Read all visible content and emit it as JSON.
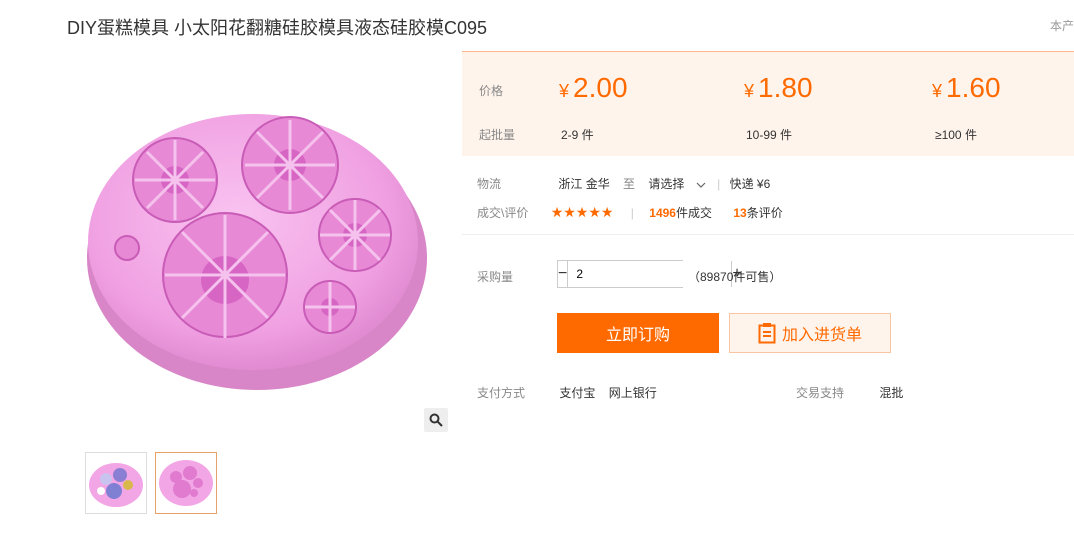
{
  "title": "DIY蛋糕模具 小太阳花翻糖硅胶模具液态硅胶模C095",
  "corner_link": "本产",
  "price": {
    "price_label": "价格",
    "moq_label": "起批量",
    "yen_symbol": "¥",
    "tiers": [
      {
        "price": "2.00",
        "range": "2-9 件"
      },
      {
        "price": "1.80",
        "range": "10-99 件"
      },
      {
        "price": "1.60",
        "range": "≥100 件"
      }
    ]
  },
  "logistics": {
    "label": "物流",
    "origin": "浙江 金华",
    "to": "至",
    "destination": "请选择",
    "express": "快递 ¥6"
  },
  "deals": {
    "label": "成交\\评价",
    "stars": "★★★★★",
    "deal_count": "1496",
    "deal_suffix": "件成交",
    "review_count": "13",
    "review_suffix": "条评价"
  },
  "purchase": {
    "label": "采购量",
    "minus": "−",
    "plus": "+",
    "quantity": "2",
    "available": "（89870件可售）"
  },
  "buttons": {
    "buy_now": "立即订购",
    "add_to_cart": "加入进货单"
  },
  "payment": {
    "label": "支付方式",
    "methods": [
      "支付宝",
      "网上银行"
    ],
    "trade_label": "交易支持",
    "trade_value": "混批"
  },
  "colors": {
    "accent": "#ff6a00",
    "price_bg": "#fff4ec",
    "mold_pink": "#f3a6e6"
  },
  "icons": {
    "zoom": "magnifier-icon",
    "dropdown": "chevron-down-icon",
    "cart": "clipboard-icon"
  }
}
